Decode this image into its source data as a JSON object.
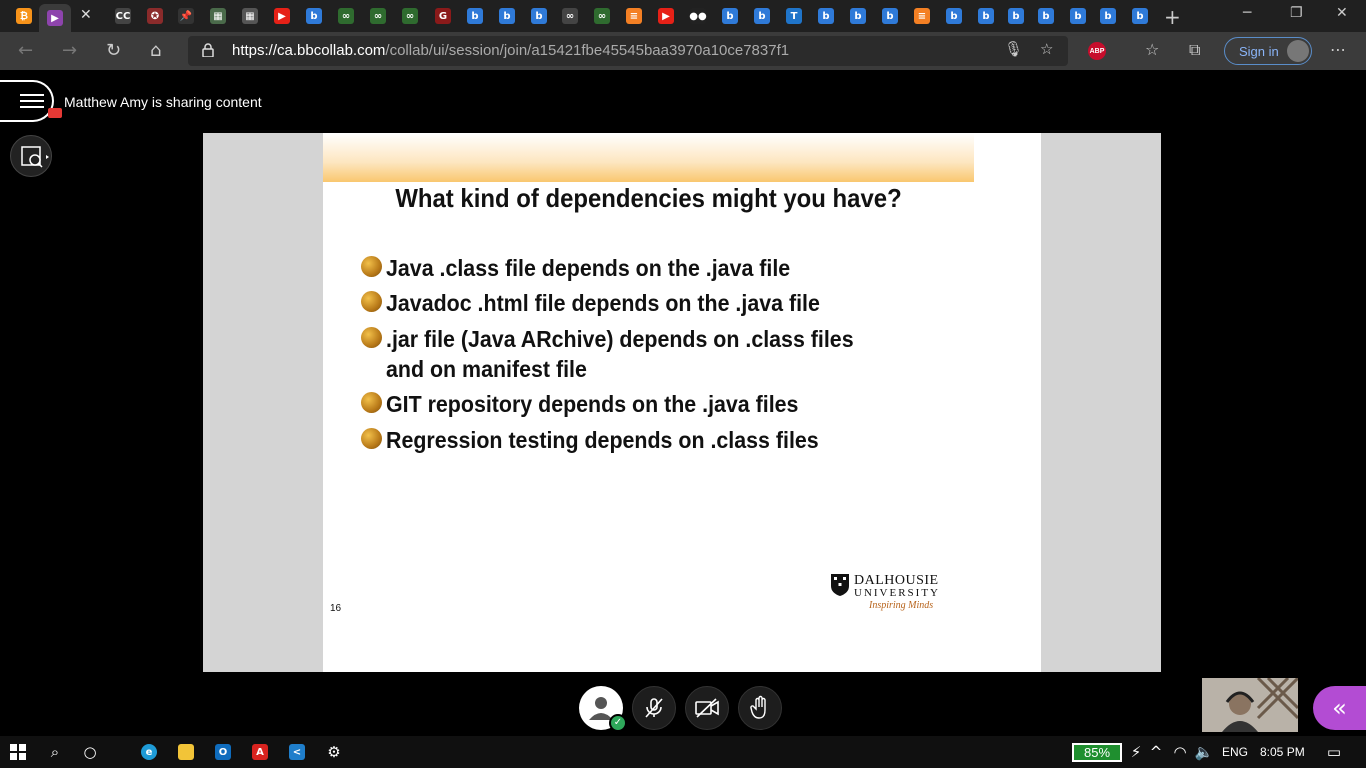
{
  "browser": {
    "tabs": [
      {
        "icon": "bitcoin-icon",
        "color": "#f7931a",
        "glyph": "₿"
      },
      {
        "icon": "play-icon",
        "color": "#8e44ad",
        "glyph": "▶",
        "active": true
      },
      {
        "icon": "cc-icon",
        "color": "#444444",
        "glyph": "CC"
      },
      {
        "icon": "badge-icon",
        "color": "#8b2b2b",
        "glyph": "✪"
      },
      {
        "icon": "pin-icon",
        "color": "#333333",
        "glyph": "📌"
      },
      {
        "icon": "image-icon",
        "color": "#4a6a4a",
        "glyph": "▦"
      },
      {
        "icon": "grid-icon",
        "color": "#555555",
        "glyph": "▦"
      },
      {
        "icon": "youtube-icon",
        "color": "#e62117",
        "glyph": "▶"
      },
      {
        "icon": "bing-icon",
        "color": "#2f7ad8",
        "glyph": "b"
      },
      {
        "icon": "link-icon",
        "color": "#2f6b2f",
        "glyph": "∞"
      },
      {
        "icon": "link-icon",
        "color": "#2f6b2f",
        "glyph": "∞"
      },
      {
        "icon": "link-icon",
        "color": "#2f6b2f",
        "glyph": "∞"
      },
      {
        "icon": "g-icon",
        "color": "#8b1a1a",
        "glyph": "G"
      },
      {
        "icon": "bing-icon",
        "color": "#2f7ad8",
        "glyph": "b"
      },
      {
        "icon": "bing-icon",
        "color": "#2f7ad8",
        "glyph": "b"
      },
      {
        "icon": "bing-icon",
        "color": "#2f7ad8",
        "glyph": "b"
      },
      {
        "icon": "link-icon",
        "color": "#444444",
        "glyph": "∞"
      },
      {
        "icon": "link-icon",
        "color": "#2f6b2f",
        "glyph": "∞"
      },
      {
        "icon": "stackoverflow-icon",
        "color": "#f48024",
        "glyph": "≡"
      },
      {
        "icon": "youtube-icon",
        "color": "#e62117",
        "glyph": "▶"
      },
      {
        "icon": "medium-icon",
        "color": "#222222",
        "glyph": "●●"
      },
      {
        "icon": "bing-icon",
        "color": "#2f7ad8",
        "glyph": "b"
      },
      {
        "icon": "bing-icon",
        "color": "#2f7ad8",
        "glyph": "b"
      },
      {
        "icon": "translate-icon",
        "color": "#1f74c9",
        "glyph": "T"
      },
      {
        "icon": "bing-icon",
        "color": "#2f7ad8",
        "glyph": "b"
      },
      {
        "icon": "bing-icon",
        "color": "#2f7ad8",
        "glyph": "b"
      },
      {
        "icon": "bing-icon",
        "color": "#2f7ad8",
        "glyph": "b"
      },
      {
        "icon": "stackoverflow-icon",
        "color": "#f48024",
        "glyph": "≡"
      },
      {
        "icon": "bing-icon",
        "color": "#2f7ad8",
        "glyph": "b"
      },
      {
        "icon": "bing-icon",
        "color": "#2f7ad8",
        "glyph": "b"
      },
      {
        "icon": "bing-icon",
        "color": "#2f7ad8",
        "glyph": "b"
      },
      {
        "icon": "bing-icon",
        "color": "#2f7ad8",
        "glyph": "b"
      },
      {
        "icon": "bing-icon",
        "color": "#2f7ad8",
        "glyph": "b"
      },
      {
        "icon": "bing-icon",
        "color": "#2f7ad8",
        "glyph": "b"
      },
      {
        "icon": "bing-icon",
        "color": "#2f7ad8",
        "glyph": "b"
      }
    ],
    "url_host": "https://ca.bbcollab.com",
    "url_path": "/collab/ui/session/join/a15421fbe45545baa3970a10ce7837f1",
    "abp_label": "ABP",
    "signin_label": "Sign in"
  },
  "session": {
    "sharing_text": "Matthew Amy is sharing content"
  },
  "slide": {
    "title": "What kind of dependencies might you have?",
    "bullets": [
      [
        "Java .class file depends on the .java file"
      ],
      [
        "Javadoc .html file depends on the .java file"
      ],
      [
        ".jar file (Java ARchive) depends on .class files and on manifest file"
      ],
      [
        "GIT repository depends on the .java files"
      ],
      [
        "Regression testing depends on .class files"
      ]
    ],
    "page_number": "16",
    "logo_name_line1": "DALHOUSIE",
    "logo_name_line2": "UNIVERSITY",
    "logo_tagline": "Inspiring Minds"
  },
  "taskbar": {
    "battery": "85%",
    "language": "ENG",
    "time": "8:05 PM"
  }
}
